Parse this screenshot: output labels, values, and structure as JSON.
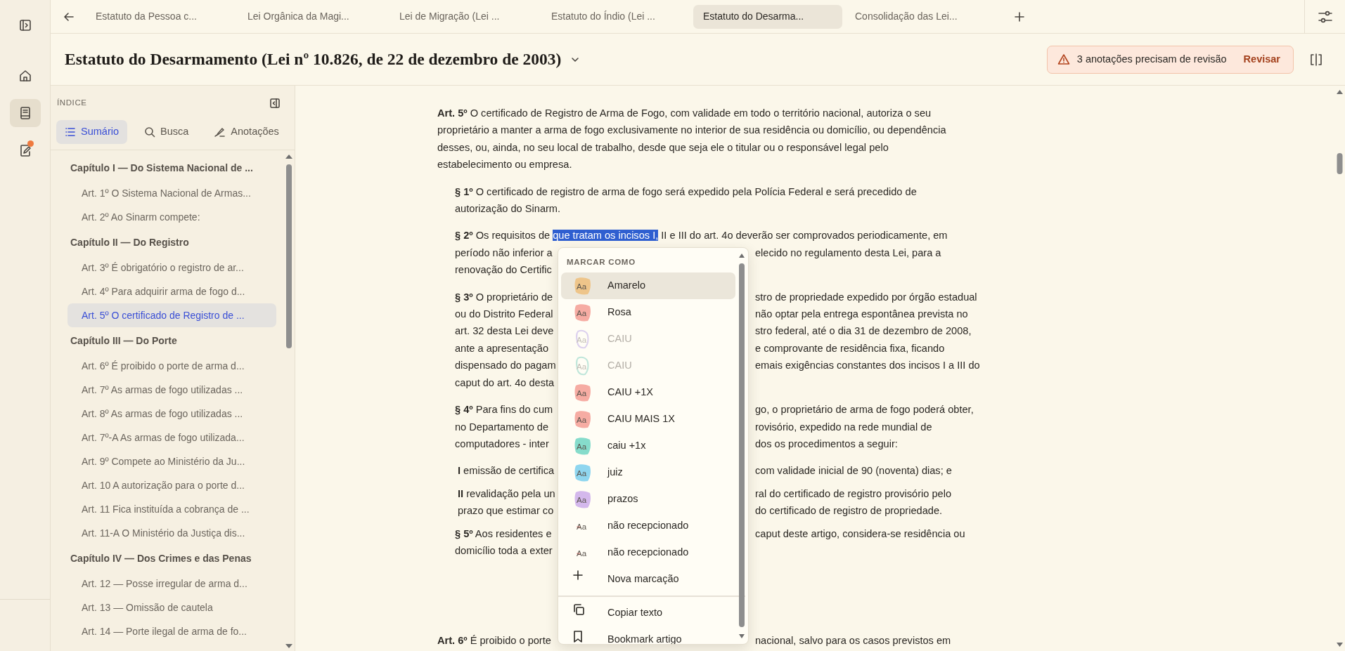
{
  "rail": {
    "items": [
      {
        "kind": "home",
        "selected": false,
        "badge": false
      },
      {
        "kind": "book",
        "selected": true,
        "badge": false
      },
      {
        "kind": "note",
        "selected": false,
        "badge": true
      }
    ]
  },
  "tabs": [
    {
      "label": "Estatuto da Pessoa c...",
      "selected": false
    },
    {
      "label": "Lei Orgânica da Magi...",
      "selected": false
    },
    {
      "label": "Lei de Migração (Lei ...",
      "selected": false
    },
    {
      "label": "Estatuto do Índio (Lei ...",
      "selected": false
    },
    {
      "label": "Estatuto do Desarma...",
      "selected": true
    },
    {
      "label": "Consolidação das Lei...",
      "selected": false
    }
  ],
  "document": {
    "title": "Estatuto do Desarmamento (Lei nº 10.826, de 22 de dezembro de 2003)"
  },
  "alert": {
    "text": "3 anotações precisam de revisão",
    "action": "Revisar"
  },
  "index": {
    "heading": "ÍNDICE",
    "modes": [
      {
        "kind": "list",
        "label": "Sumário",
        "selected": true
      },
      {
        "kind": "search",
        "label": "Busca",
        "selected": false
      },
      {
        "kind": "pen",
        "label": "Anotações",
        "selected": false
      }
    ],
    "chapters": [
      {
        "label": "Capítulo I — Do Sistema Nacional de ...",
        "children": [
          {
            "label": "Art. 1º O Sistema Nacional de Armas...",
            "selected": false
          },
          {
            "label": "Art. 2º Ao Sinarm compete:",
            "selected": false
          }
        ]
      },
      {
        "label": "Capítulo II — Do Registro",
        "children": [
          {
            "label": "Art. 3º É obrigatório o registro de ar...",
            "selected": false
          },
          {
            "label": "Art. 4º Para adquirir arma de fogo d...",
            "selected": false
          },
          {
            "label": "Art. 5º O certificado de Registro de ...",
            "selected": true
          }
        ]
      },
      {
        "label": "Capítulo III — Do Porte",
        "children": [
          {
            "label": "Art. 6º É proibido o porte de arma d...",
            "selected": false
          },
          {
            "label": "Art. 7º As armas de fogo utilizadas ...",
            "selected": false
          },
          {
            "label": "Art. 8º As armas de fogo utilizadas ...",
            "selected": false
          },
          {
            "label": "Art. 7º-A As armas de fogo utilizada...",
            "selected": false
          },
          {
            "label": "Art. 9º Compete ao Ministério da Ju...",
            "selected": false
          },
          {
            "label": "Art. 10 A autorização para o porte d...",
            "selected": false
          },
          {
            "label": "Art. 11 Fica instituída a cobrança de ...",
            "selected": false
          },
          {
            "label": "Art. 11-A O Ministério da Justiça dis...",
            "selected": false
          }
        ]
      },
      {
        "label": "Capítulo IV — Dos Crimes e das Penas",
        "children": [
          {
            "label": "Art. 12 — Posse irregular de arma d...",
            "selected": false
          },
          {
            "label": "Art. 13 — Omissão de cautela",
            "selected": false
          },
          {
            "label": "Art. 14 — Porte ilegal de arma de fo...",
            "selected": false
          }
        ]
      }
    ]
  },
  "content": {
    "paragraphs": [
      {
        "kind": "article",
        "lines": [
          {
            "text": "**Art. 5º** O certificado de Registro de Arma de Fogo, com validade em todo o território nacional, autoriza o seu"
          },
          {
            "text": "proprietário a manter a arma de fogo exclusivamente no interior de sua residência ou domicílio, ou dependência"
          },
          {
            "text": "desses, ou, ainda, no seu local de trabalho, desde que seja ele o titular ou o responsável legal pelo"
          },
          {
            "text": "estabelecimento ou empresa."
          }
        ]
      },
      {
        "kind": "paragraph",
        "lines": [
          {
            "text": "**§ 1º** O certificado de registro de arma de fogo será expedido pela Polícia Federal e será precedido de"
          },
          {
            "text": "autorização do Sinarm."
          }
        ]
      },
      {
        "kind": "paragraph",
        "lines": [
          {
            "text": "**§ 2º** Os requisitos de ",
            "selection": "que tratam os incisos I,",
            "after": " II e III do art. 4o deverão ser comprovados periodicamente, em"
          },
          {
            "left": "período não inferior a",
            "right": "elecido no regulamento desta Lei, para a"
          },
          {
            "left": "renovação do Certific"
          }
        ]
      },
      {
        "kind": "paragraph",
        "lines": [
          {
            "left": "**§ 3º** O proprietário de",
            "right": "stro de propriedade expedido por órgão estadual"
          },
          {
            "left": "ou do Distrito Federal",
            "right": "não optar pela entrega espontânea prevista no"
          },
          {
            "left": "art. 32 desta Lei deve",
            "right": "stro federal, até o dia 31 de dezembro de 2008,"
          },
          {
            "left": "ante a apresentação",
            "right": "e comprovante de residência fixa, ficando"
          },
          {
            "left": "dispensado do pagam",
            "right": "emais exigências constantes dos incisos I a III do"
          },
          {
            "left": "caput do art. 4o desta"
          }
        ]
      },
      {
        "kind": "paragraph",
        "lines": [
          {
            "left": "**§ 4º** Para fins do cum",
            "right": "go, o proprietário de arma de fogo poderá obter,"
          },
          {
            "left": "no Departamento de",
            "right": "rovisório, expedido na rede mundial de"
          },
          {
            "left": "computadores - inter",
            "right": "dos os procedimentos a seguir:"
          }
        ]
      },
      {
        "kind": "item",
        "lines": [
          {
            "left": "**I** emissão de certifica",
            "right": "com validade inicial de 90 (noventa) dias; e"
          }
        ]
      },
      {
        "kind": "item",
        "lines": [
          {
            "left": "**II** revalidação pela un",
            "right": "ral do certificado de registro provisório pelo"
          },
          {
            "left": "prazo que estimar co",
            "right": "do certificado de registro de propriedade."
          }
        ]
      },
      {
        "kind": "paragraph",
        "lines": [
          {
            "left": "**§ 5º** Aos residentes e",
            "right": "caput deste artigo, considera-se residência ou"
          },
          {
            "left": "domicílio toda a exter"
          }
        ]
      },
      {
        "kind": "article",
        "lines": [
          {
            "left": "**Art. 6º** É proibido o porte",
            "right": "nacional, salvo para os casos previstos em"
          }
        ]
      }
    ]
  },
  "menu": {
    "heading": "MARCAR COMO",
    "marks": [
      {
        "kind": "fill",
        "sample": "Aa",
        "label": "Amarelo",
        "color": "#eec58a",
        "selected": true,
        "disabled": false
      },
      {
        "kind": "fill",
        "sample": "Aa",
        "label": "Rosa",
        "color": "#f6aca3",
        "selected": false,
        "disabled": false
      },
      {
        "kind": "outline",
        "sample": "Aa",
        "label": "CAIU",
        "color": "#dcd0ee",
        "selected": false,
        "disabled": true
      },
      {
        "kind": "outline",
        "sample": "Aa",
        "label": "CAIU",
        "color": "#bfe6da",
        "selected": false,
        "disabled": true
      },
      {
        "kind": "fill",
        "sample": "Aa",
        "label": "CAIU +1X",
        "color": "#f6aca3",
        "selected": false,
        "disabled": false
      },
      {
        "kind": "fill",
        "sample": "Aa",
        "label": "CAIU MAIS 1X",
        "color": "#f6aca3",
        "selected": false,
        "disabled": false
      },
      {
        "kind": "fill",
        "sample": "Aa",
        "label": "caiu +1x",
        "color": "#86dccb",
        "selected": false,
        "disabled": false
      },
      {
        "kind": "fill",
        "sample": "Aa",
        "label": "juiz",
        "color": "#8fd6ef",
        "selected": false,
        "disabled": false
      },
      {
        "kind": "fill",
        "sample": "Aa",
        "label": "prazos",
        "color": "#d4b8ec",
        "selected": false,
        "disabled": false
      },
      {
        "kind": "dot",
        "sample": "Aa",
        "label": "não recepcionado",
        "color": "#f2a9a3",
        "selected": false,
        "disabled": false
      },
      {
        "kind": "dot",
        "sample": "Aa",
        "label": "não recepcionado",
        "color": "#f2a9a3",
        "selected": false,
        "disabled": false
      }
    ],
    "add": {
      "label": "Nova marcação"
    },
    "actions": [
      {
        "kind": "copy",
        "label": "Copiar texto"
      },
      {
        "kind": "bookmark",
        "label": "Bookmark artigo"
      }
    ]
  }
}
